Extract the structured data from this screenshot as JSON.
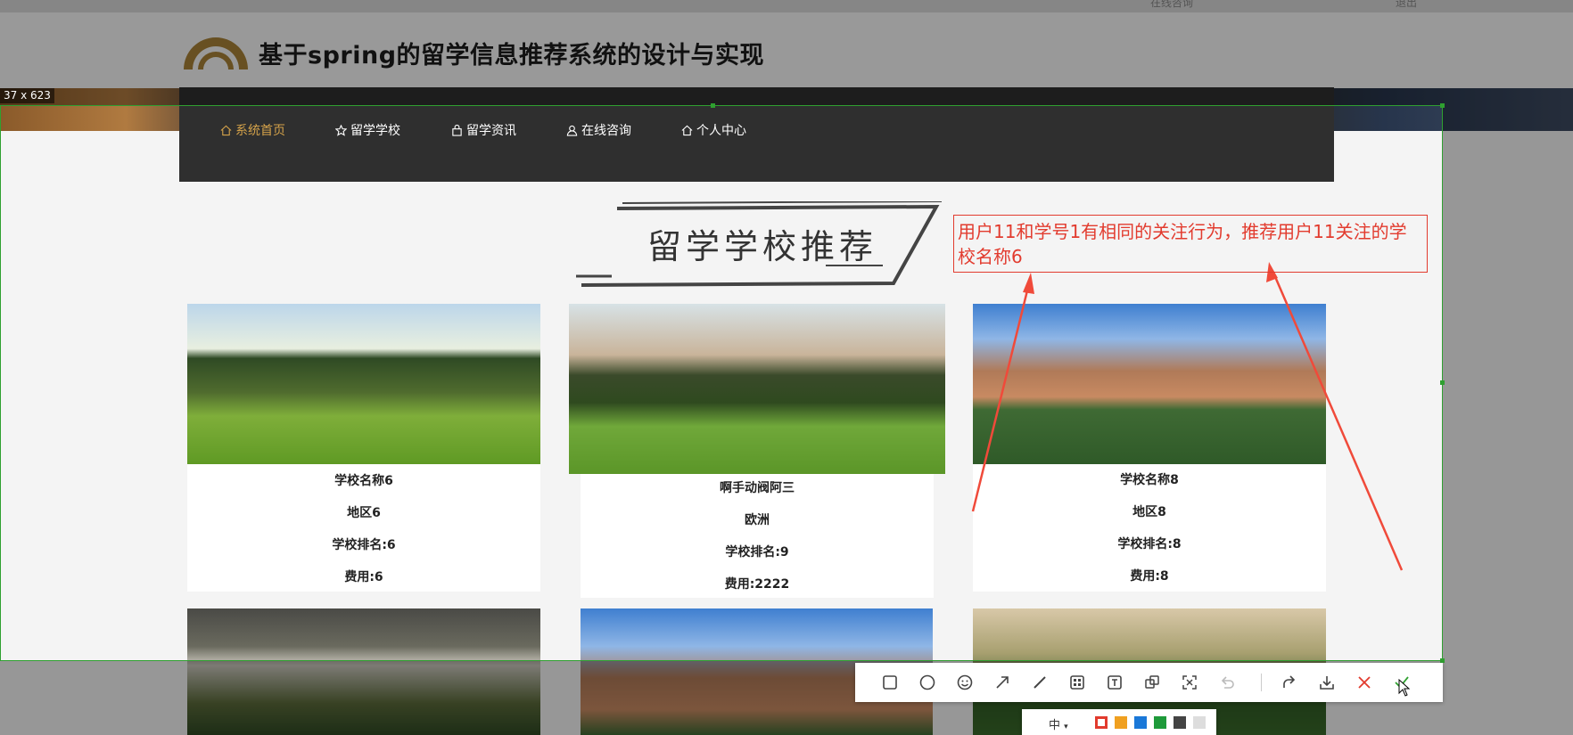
{
  "top_strip": {
    "left_text": "在线咨询",
    "right_text": "退出"
  },
  "site": {
    "title": "基于spring的留学信息推荐系统的设计与实现"
  },
  "nav": [
    {
      "label": "系统首页",
      "icon": "home-icon",
      "active": true
    },
    {
      "label": "留学学校",
      "icon": "star-icon",
      "active": false
    },
    {
      "label": "留学资讯",
      "icon": "bag-icon",
      "active": false
    },
    {
      "label": "在线咨询",
      "icon": "user-icon",
      "active": false
    },
    {
      "label": "个人中心",
      "icon": "home-icon",
      "active": false
    }
  ],
  "selection": {
    "size_label": "37 x 623"
  },
  "section": {
    "title": "留学学校推荐"
  },
  "annotation": {
    "text": "用户11和学号1有相同的关注行为，推荐用户11关注的学校名称6"
  },
  "cards": [
    {
      "name": "学校名称6",
      "region": "地区6",
      "rank": "学校排名:6",
      "fee": "费用:6"
    },
    {
      "name": "啊手动阀阿三",
      "region": "欧洲",
      "rank": "学校排名:9",
      "fee": "费用:2222"
    },
    {
      "name": "学校名称8",
      "region": "地区8",
      "rank": "学校排名:8",
      "fee": "费用:8"
    }
  ],
  "toolbar": {
    "tools": [
      "rectangle-tool",
      "ellipse-tool",
      "emoji-tool",
      "arrow-tool",
      "line-tool",
      "mosaic-tool",
      "text-tool",
      "pin-tool",
      "ocr-tool",
      "undo-tool",
      "share-tool",
      "download-tool",
      "cancel-tool",
      "confirm-tool"
    ],
    "size_label": "中",
    "colors": [
      "#e23b2e",
      "#f0a020",
      "#1a78d8",
      "#1e9a3a",
      "#444444",
      "#dddddd"
    ]
  },
  "colors": {
    "nav_bg": "#2f2f2f",
    "accent": "#d4a24a",
    "annotation": "#e23b2e",
    "selection": "#2fa030"
  }
}
